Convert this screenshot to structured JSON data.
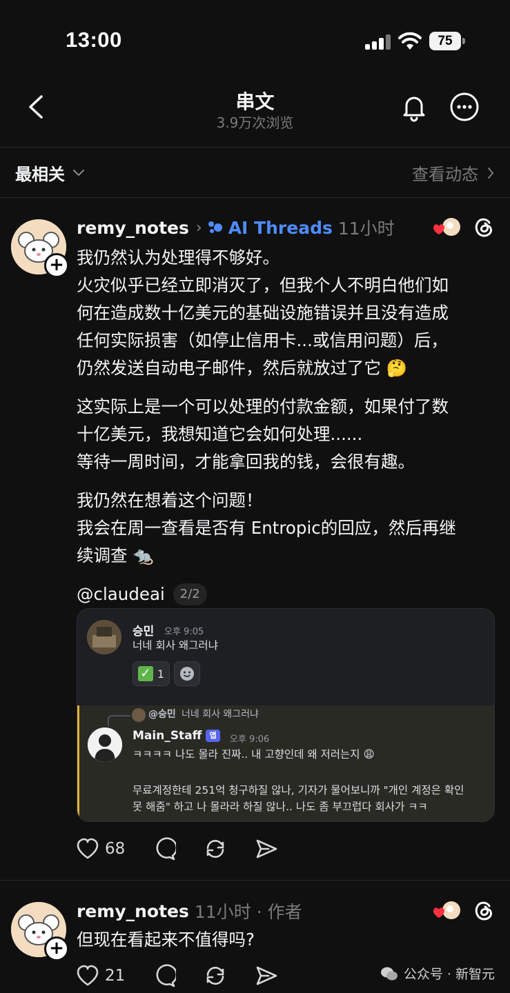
{
  "status_bar": {
    "time": "13:00",
    "battery": "75"
  },
  "header": {
    "title": "串文",
    "subtitle": "3.9万次浏览"
  },
  "sortbar": {
    "sort_label": "最相关",
    "activity_link": "查看动态"
  },
  "post1": {
    "username": "remy_notes",
    "topic": "AI Threads",
    "time": "11小时",
    "paragraphs": [
      [
        "我仍然认为处理得不够好。",
        "火灾似乎已经立即消灭了，但我个人不明白他们如",
        "何在造成数十亿美元的基础设施错误并且没有造成",
        "任何实际损害（如停止信用卡...或信用问题）后，",
        "仍然发送自动电子邮件，然后就放过了它 🤔"
      ],
      [
        "这实际上是一个可以处理的付款金额，如果付了数",
        "十亿美元，我想知道它会如何处理......",
        "等待一周时间，才能拿回我的钱，会很有趣。"
      ],
      [
        "我仍然在想着这个问题！",
        "我会在周一查看是否有 Entropic的回应，然后再继",
        "续调查 🐀"
      ]
    ],
    "mention": "@claudeai",
    "page_indicator": "2/2",
    "likes": "68"
  },
  "embed": {
    "msg1": {
      "name": "승민",
      "time": "오후 9:05",
      "text": "너네 회사 왜그러냐",
      "reaction_count": "1"
    },
    "reply_ref": {
      "name": "@승민",
      "text": "너네 회사 왜그러냐"
    },
    "msg2": {
      "name": "Main_Staff",
      "tag": "앱",
      "time": "오후 9:06",
      "line1": "ㅋㅋㅋㅋ 나도 몰라 진짜.. 내 고향인데 왜 저러는지 😩",
      "line2": "무료계정한테 251억 청구하질 않나, 기자가 물어보니까 \"개인 계정은 확인",
      "line3": "못 해줌\" 하고 나 몰라라 하질 않나.. 나도 좀 부끄럽다 회사가 ㅋㅋ"
    }
  },
  "post2": {
    "username": "remy_notes",
    "time": "11小时",
    "author_tag": "· 作者",
    "text": "但现在看起来不值得吗?",
    "likes": "21"
  },
  "watermark": {
    "text": "公众号 · 新智元"
  }
}
